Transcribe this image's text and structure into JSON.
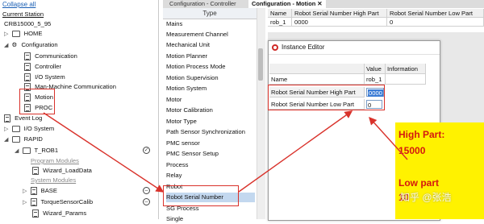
{
  "tree": {
    "collapse_all": "Collapse all",
    "section": "Current Station",
    "nodes": [
      "CRB15000_5_95",
      "HOME",
      "Configuration",
      "Communication",
      "Controller",
      "I/O System",
      "Man-Machine Communication",
      "Motion",
      "PROC",
      "Event Log",
      "I/O System",
      "RAPID",
      "T_ROB1",
      "Program Modules",
      "Wizard_LoadData",
      "System Modules",
      "BASE",
      "TorqueSensorCalib",
      "Wizard_Params"
    ]
  },
  "tabs": [
    "Configuration - Controller",
    "Configuration - Motion"
  ],
  "type_panel": {
    "header": "Type",
    "items": [
      "Mains",
      "Measurement Channel",
      "Mechanical Unit",
      "Motion Planner",
      "Motion Process Mode",
      "Motion Supervision",
      "Motion System",
      "Motor",
      "Motor Calibration",
      "Motor Type",
      "Path Sensor Synchronization",
      "PMC sensor",
      "PMC Sensor Setup",
      "Process",
      "Relay",
      "Robot",
      "Robot Serial Number",
      "SG Process",
      "Single"
    ],
    "selected": "Robot Serial Number"
  },
  "grid": {
    "headers": [
      "Name",
      "Robot Serial Number High Part",
      "Robot Serial Number Low Part"
    ],
    "row": [
      "rob_1",
      "0000",
      "0"
    ]
  },
  "instance_editor": {
    "title": "Instance Editor",
    "headers": [
      "Parameter",
      "Value",
      "Information"
    ],
    "rows": [
      {
        "param": "Name",
        "value": "rob_1"
      },
      {
        "param": "Robot Serial Number High Part",
        "value": "0000"
      },
      {
        "param": "Robot Serial Number Low Part",
        "value": "0"
      }
    ]
  },
  "note": {
    "high_label": "High Part:",
    "high_value": "15000",
    "low_label": "Low part",
    "low_value": "10"
  },
  "watermark": "知乎 @张浩",
  "colors": {
    "annotation_red": "#d9322b",
    "note_yellow": "#fff200",
    "note_text": "#d4190f",
    "selection_blue": "#c3d8ef"
  }
}
